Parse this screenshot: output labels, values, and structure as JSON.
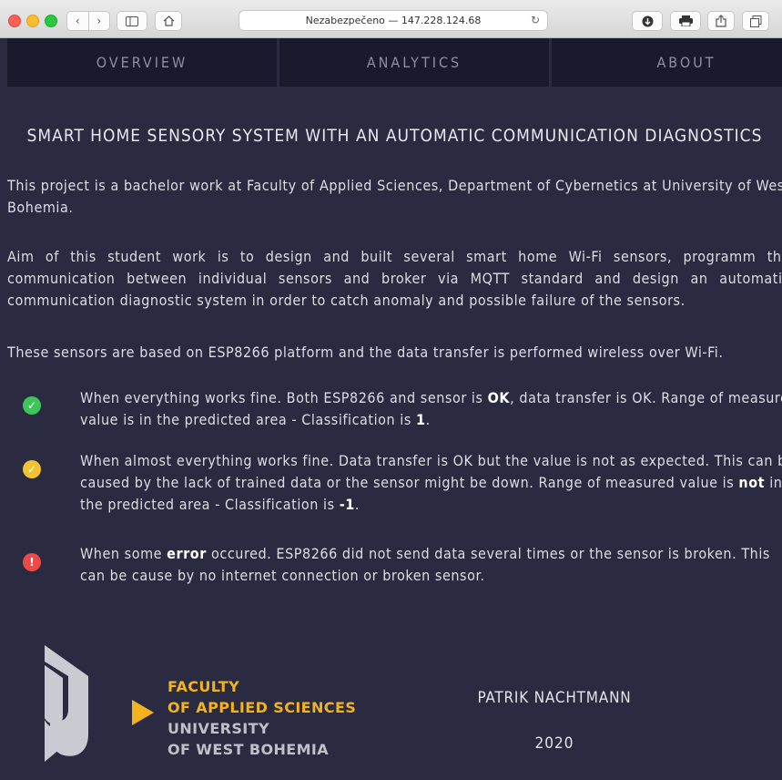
{
  "browser": {
    "address": "Nezabezpečeno — 147.228.124.68",
    "icons": [
      "back-icon",
      "forward-icon",
      "sidebar-icon",
      "home-icon",
      "reload-icon",
      "download-icon",
      "print-icon",
      "share-icon",
      "tabs-icon"
    ]
  },
  "nav": {
    "tabs": [
      "OVERVIEW",
      "ANALYTICS",
      "ABOUT"
    ]
  },
  "content": {
    "heading": "SMART HOME SENSORY SYSTEM WITH AN AUTOMATIC COMMUNICATION DIAGNOSTICS",
    "paragraphs": [
      "This project is a bachelor work at Faculty of Applied Sciences, Department of Cybernetics at University of West Bohemia.",
      "Aim of this student work is to design and built several smart home Wi-Fi sensors, programm the communication between individual sensors and broker via MQTT standard and design an automatic communication diagnostic system in order to catch anomaly and possible failure of the sensors.",
      "These sensors are based on ESP8266 platform and the data transfer is performed wireless over Wi-Fi."
    ],
    "statuses": [
      {
        "icon": "check-icon",
        "color": "#3ec55a",
        "t1": "When everything works fine. Both ESP8266 and sensor is ",
        "b1": "OK",
        "t2": ", data transfer is OK. Range of measured value is in the predicted area - Classification is ",
        "b2": "1",
        "t3": "."
      },
      {
        "icon": "check-icon",
        "color": "#f1c232",
        "t1": "When almost everything works fine. Data transfer is OK but the value is not as expected. This can be caused by the lack of trained data or the sensor might be down. Range of measured value is ",
        "b1": "not",
        "t2": " in the predicted area - Classification is ",
        "b2": "-1",
        "t3": "."
      },
      {
        "icon": "exclamation-icon",
        "color": "#ec4a46",
        "t1": "When some ",
        "b1": "error",
        "t2": " occured. ESP8266 did not send data several times or the sensor is broken. This can be cause by no internet connection or broken sensor.",
        "b2": "",
        "t3": ""
      }
    ]
  },
  "footer": {
    "logo_lines": [
      "FACULTY",
      "OF APPLIED SCIENCES",
      "UNIVERSITY",
      "OF WEST BOHEMIA"
    ],
    "author": "PATRIK NACHTMANN",
    "year": "2020"
  }
}
